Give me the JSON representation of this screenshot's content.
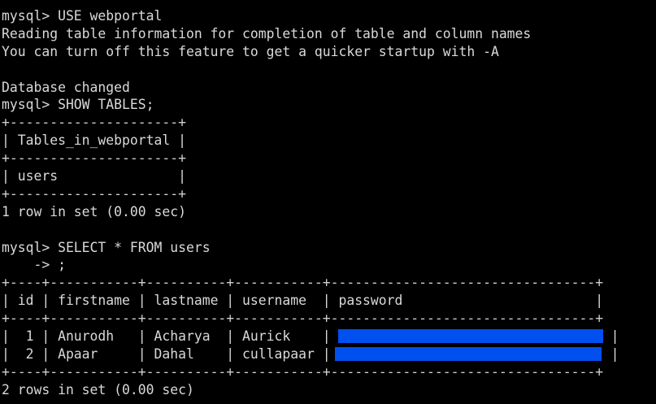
{
  "window": {
    "background": "#000000",
    "foreground": "#d9d9d9",
    "redaction_color": "#0050f0"
  },
  "lines": [
    "mysql> USE webportal",
    "Reading table information for completion of table and column names",
    "You can turn off this feature to get a quicker startup with -A",
    "",
    "Database changed",
    "mysql> SHOW TABLES;",
    "+---------------------+",
    "| Tables_in_webportal |",
    "+---------------------+",
    "| users               |",
    "+---------------------+",
    "1 row in set (0.00 sec)",
    "",
    "mysql> SELECT * FROM users",
    "    -> ;",
    "+----+-----------+----------+-----------+---------------------------------+",
    "| id | firstname | lastname | username  | password                        |",
    "+----+-----------+----------+-----------+---------------------------------+"
  ],
  "users_rows": [
    {
      "left": "|  1 | Anurodh   | Acharya  | Aurick    |",
      "right": "|"
    },
    {
      "left": "|  2 | Apaar     | Dahal    | cullapaar |",
      "right": "|"
    }
  ],
  "footer_lines": [
    "+----+-----------+----------+-----------+---------------------------------+",
    "2 rows in set (0.00 sec)"
  ]
}
